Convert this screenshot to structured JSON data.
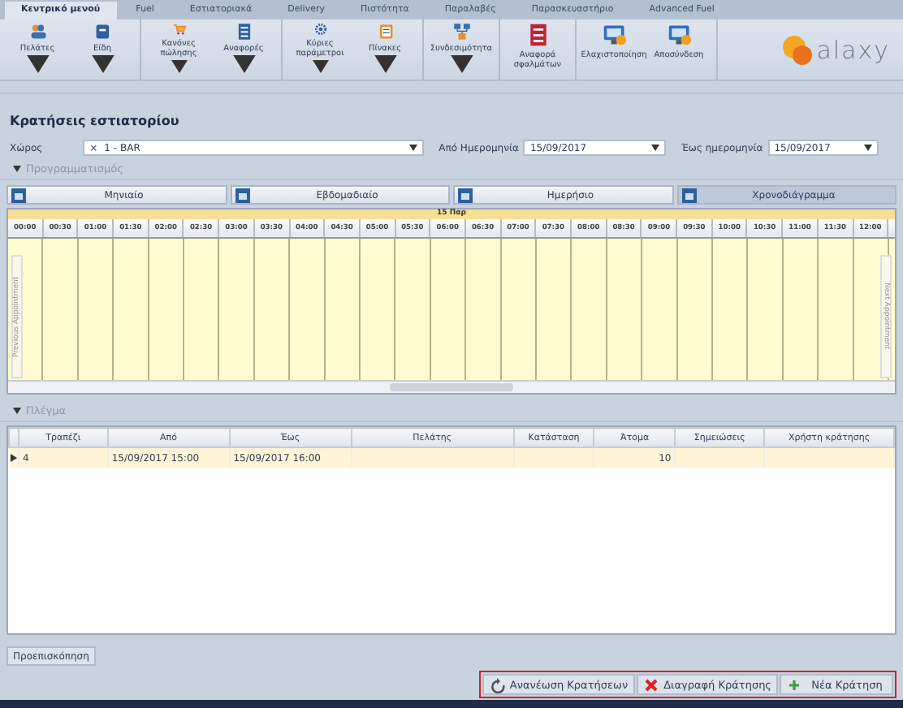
{
  "ribbon_tabs": [
    {
      "label": "Κεντρικό μενού",
      "selected": true
    },
    {
      "label": "Fuel",
      "selected": false
    },
    {
      "label": "Εστιατοριακά",
      "selected": false
    },
    {
      "label": "Delivery",
      "selected": false
    },
    {
      "label": "Πιστότητα",
      "selected": false
    },
    {
      "label": "Παραλαβές",
      "selected": false
    },
    {
      "label": "Παρασκευαστήριο",
      "selected": false
    },
    {
      "label": "Advanced Fuel",
      "selected": false
    }
  ],
  "ribbon_buttons": [
    {
      "label": "Πελάτες",
      "dropdown": true
    },
    {
      "label": "Είδη",
      "dropdown": true
    },
    {
      "label": "Κανόνες πώλησης",
      "dropdown": true
    },
    {
      "label": "Αναφορές",
      "dropdown": true
    },
    {
      "label": "Κύριες παράμετροι",
      "dropdown": true
    },
    {
      "label": "Πίνακες",
      "dropdown": true
    },
    {
      "label": "Συνδεσιμότητα",
      "dropdown": true
    },
    {
      "label": "Αναφορά σφαλμάτων",
      "dropdown": false
    },
    {
      "label": "Ελαχιστοποίηση",
      "dropdown": false
    },
    {
      "label": "Αποσύνδεση",
      "dropdown": false
    }
  ],
  "logo": {
    "text": "alaxy"
  },
  "page_title": "Κρατήσεις εστιατορίου",
  "filters": {
    "space_label": "Χώρος",
    "space_value": "1 - BAR",
    "clear": "×",
    "from_label": "Από Ημερομηνία",
    "from_value": "15/09/2017",
    "to_label": "Έως ημερομηνία",
    "to_value": "15/09/2017"
  },
  "scheduling": {
    "title": "Προγραμματισμός",
    "expanded": true,
    "views": [
      {
        "label": "Μηνιαίο",
        "selected": false
      },
      {
        "label": "Εβδομαδιαίο",
        "selected": false
      },
      {
        "label": "Ημερήσιο",
        "selected": false
      },
      {
        "label": "Χρονοδιάγραμμα",
        "selected": true
      }
    ],
    "day": "15 Παρ",
    "times": [
      "00:00",
      "00:30",
      "01:00",
      "01:30",
      "02:00",
      "02:30",
      "03:00",
      "03:30",
      "04:00",
      "04:30",
      "05:00",
      "05:30",
      "06:00",
      "06:30",
      "07:00",
      "07:30",
      "08:00",
      "08:30",
      "09:00",
      "09:30",
      "10:00",
      "10:30",
      "11:00",
      "11:30",
      "12:00"
    ],
    "previous": "Previous Appointment",
    "next": "Next Appointment"
  },
  "grid": {
    "title": "Πλέγμα",
    "expanded": true,
    "columns": [
      "Τραπέζι",
      "Από",
      "Έως",
      "Πελάτης",
      "Κατάσταση",
      "Άτομα",
      "Σημειώσεις",
      "Χρήστη κράτησης"
    ],
    "rows": [
      {
        "selected": true,
        "cells": [
          "4",
          "15/09/2017 15:00",
          "15/09/2017 16:00",
          null,
          null,
          "10",
          null,
          null
        ]
      }
    ]
  },
  "preview_button": "Προεπισκόπηση",
  "actions": [
    {
      "label": "Ανανέωση Κρατήσεων"
    },
    {
      "label": "Διαγραφή Κράτησης"
    },
    {
      "label": "Νέα Κράτηση"
    }
  ]
}
